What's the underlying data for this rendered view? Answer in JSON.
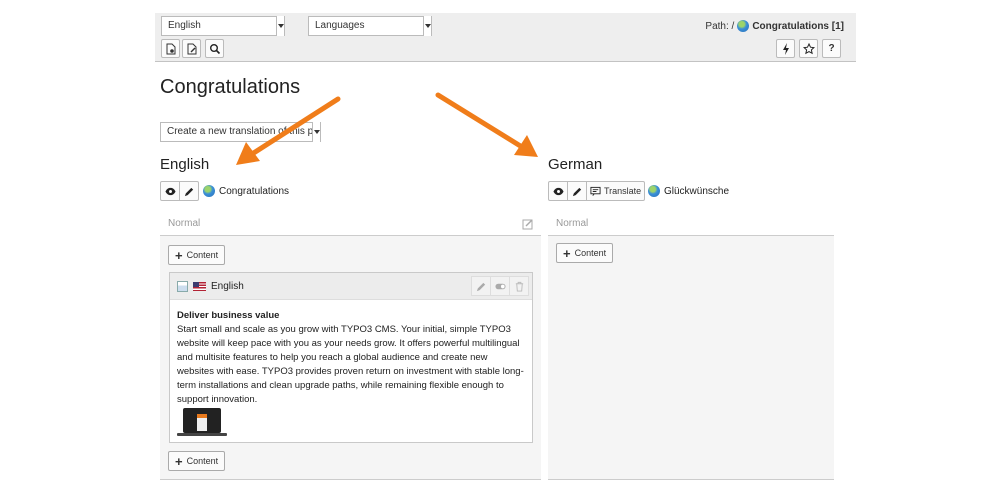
{
  "docheader": {
    "language_select": "English",
    "languages_select": "Languages",
    "path_label": "Path: /",
    "path_page": "Congratulations [1]",
    "left_buttons": [
      "view-page-icon",
      "edit-page-icon",
      "search-icon"
    ],
    "right_buttons": [
      "flash-icon",
      "star-icon",
      "help-icon"
    ],
    "help_label": "?"
  },
  "page": {
    "title": "Congratulations",
    "translation_select": "Create a new translation of this page"
  },
  "columns": {
    "english": {
      "title": "English",
      "page_link": "Congratulations",
      "col_name": "Normal",
      "add_content": "Content",
      "add_content_bottom": "Content",
      "content_element": {
        "language": "English",
        "headline": "Deliver business value",
        "text": "Start small and scale as you grow with TYPO3 CMS. Your initial, simple TYPO3 website will keep pace with you as your needs grow. It offers powerful multilingual and multisite features to help you reach a global audience and create new websites with ease. TYPO3 provides proven return on investment with stable long-term installations and clean upgrade paths, while remaining flexible enough to support innovation."
      }
    },
    "german": {
      "title": "German",
      "translate_label": "Translate",
      "page_link": "Glückwünsche",
      "col_name": "Normal",
      "add_content": "Content"
    }
  },
  "colors": {
    "accent_arrow": "#f07d1a",
    "docheader_bg": "#eeeeee",
    "column_bg": "#f5f5f5"
  }
}
